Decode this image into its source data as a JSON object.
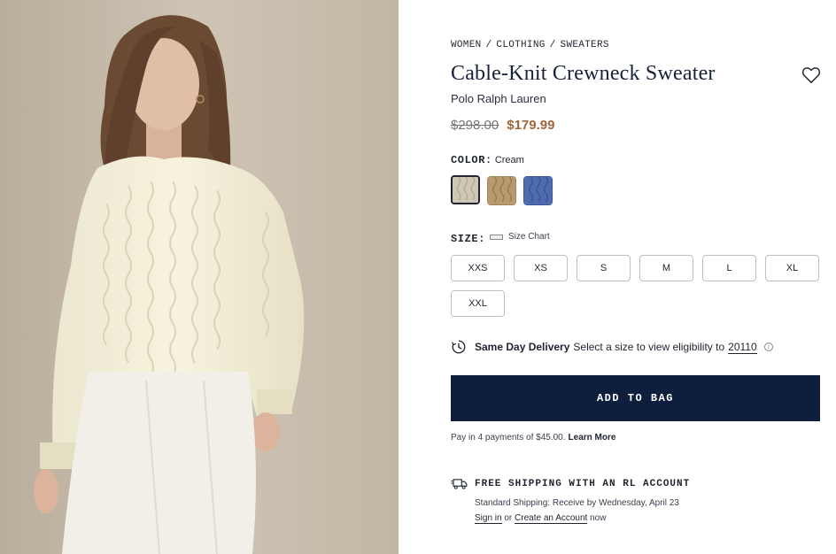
{
  "breadcrumb": {
    "items": [
      "WOMEN",
      "CLOTHING",
      "SWEATERS"
    ],
    "separator": "/"
  },
  "product": {
    "title": "Cable-Knit Crewneck Sweater",
    "brand": "Polo Ralph Lauren",
    "price_original": "$298.00",
    "price_sale": "$179.99",
    "wishlist_icon": "heart-icon"
  },
  "color": {
    "label": "COLOR:",
    "selected": "Cream",
    "swatches": [
      {
        "name": "cream",
        "hex": "#cfc7b6",
        "selected": true
      },
      {
        "name": "camel",
        "hex": "#b79a6e",
        "selected": false
      },
      {
        "name": "blue",
        "hex": "#4f6bb0",
        "selected": false
      }
    ]
  },
  "size": {
    "label": "SIZE:",
    "chart_label": "Size Chart",
    "options": [
      "XXS",
      "XS",
      "S",
      "M",
      "L",
      "XL",
      "XXL"
    ]
  },
  "delivery": {
    "title": "Same Day Delivery",
    "text": "Select a size to view eligibility to",
    "zip": "20110",
    "info_icon": "i"
  },
  "cart": {
    "add_label": "ADD TO BAG"
  },
  "payment": {
    "text": "Pay in 4 payments of $45.00.",
    "learn_more": "Learn More"
  },
  "shipping": {
    "title": "FREE SHIPPING WITH AN RL ACCOUNT",
    "standard": "Standard Shipping: Receive by Wednesday, April 23",
    "sign_in": "Sign in",
    "or": "or",
    "create": "Create an Account",
    "now": "now"
  },
  "colors": {
    "navy": "#0e1f3d",
    "sale_price": "#a0663b",
    "text": "#1f2430"
  }
}
